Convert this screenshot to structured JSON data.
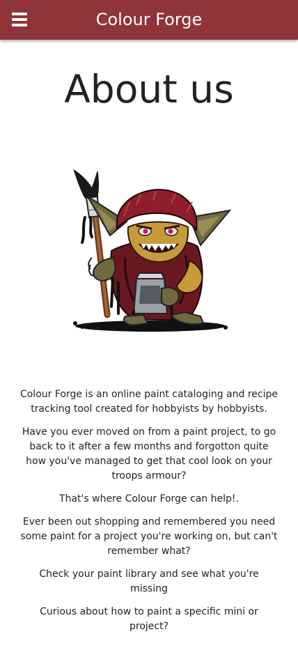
{
  "appbar": {
    "title": "Colour Forge",
    "menu_icon": "hamburger-menu-icon"
  },
  "page": {
    "title": "About us"
  },
  "illustration": {
    "subject": "goblin-painter-illustration"
  },
  "content": {
    "paragraphs": [
      "Colour Forge is an online paint cataloging and recipe tracking tool created for hobbyists by hobbyists.",
      "Have you ever moved on from a paint project, to go back to it after a few months and forgotton quite how you've managed to get that cool look on your troops armour?",
      "That's where Colour Forge can help!.",
      "Ever been out shopping and remembered you need some paint for a project you're working on, but can't remember what?",
      "Check your paint library and see what you're missing",
      "Curious about how to paint a specific mini or project?"
    ]
  },
  "colors": {
    "appbar": "#8f3439",
    "text": "#222222",
    "background": "#ffffff"
  }
}
